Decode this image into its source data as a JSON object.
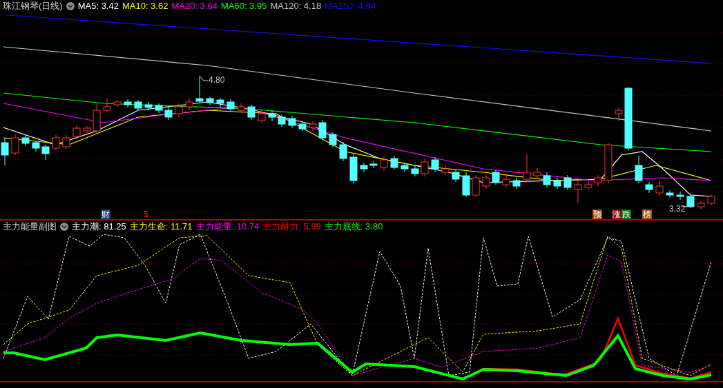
{
  "price_panel": {
    "title": "珠江钢琴(日线)",
    "moving_averages": [
      {
        "name": "MA5:",
        "value": "3.42",
        "color": "#ffffff"
      },
      {
        "name": "MA10:",
        "value": "3.62",
        "color": "#ffff00"
      },
      {
        "name": "MA20:",
        "value": "3.64",
        "color": "#ff00ff"
      },
      {
        "name": "MA60:",
        "value": "3.95",
        "color": "#00ff00"
      },
      {
        "name": "MA120:",
        "value": "4.18",
        "color": "#c8c8c8"
      },
      {
        "name": "MA250:",
        "value": "4.94",
        "color": "#1010ff"
      }
    ],
    "high_label": "4.80",
    "low_label": "3.32",
    "markers": [
      {
        "text": "财",
        "color": "#1c3f70"
      },
      {
        "text": "$",
        "color": "#ff2020"
      },
      {
        "text": "预",
        "color": "#b04a10"
      },
      {
        "text": "涨",
        "color": "#8a0a0a"
      },
      {
        "text": "跌",
        "color": "#0a7a0a"
      },
      {
        "text": "榜",
        "color": "#9a5410"
      }
    ]
  },
  "indicator_panel": {
    "title": "主力能量副图",
    "lines": [
      {
        "name": "主力潮:",
        "value": "81.25",
        "color": "#ffffff"
      },
      {
        "name": "主力生命:",
        "value": "11.71",
        "color": "#ffff00"
      },
      {
        "name": "主力能量:",
        "value": "10.74",
        "color": "#ff00ff"
      },
      {
        "name": "主力耐力:",
        "value": "5.99",
        "color": "#ff0000"
      },
      {
        "name": "主力底线:",
        "value": "3.80",
        "color": "#00ff00"
      }
    ]
  }
}
